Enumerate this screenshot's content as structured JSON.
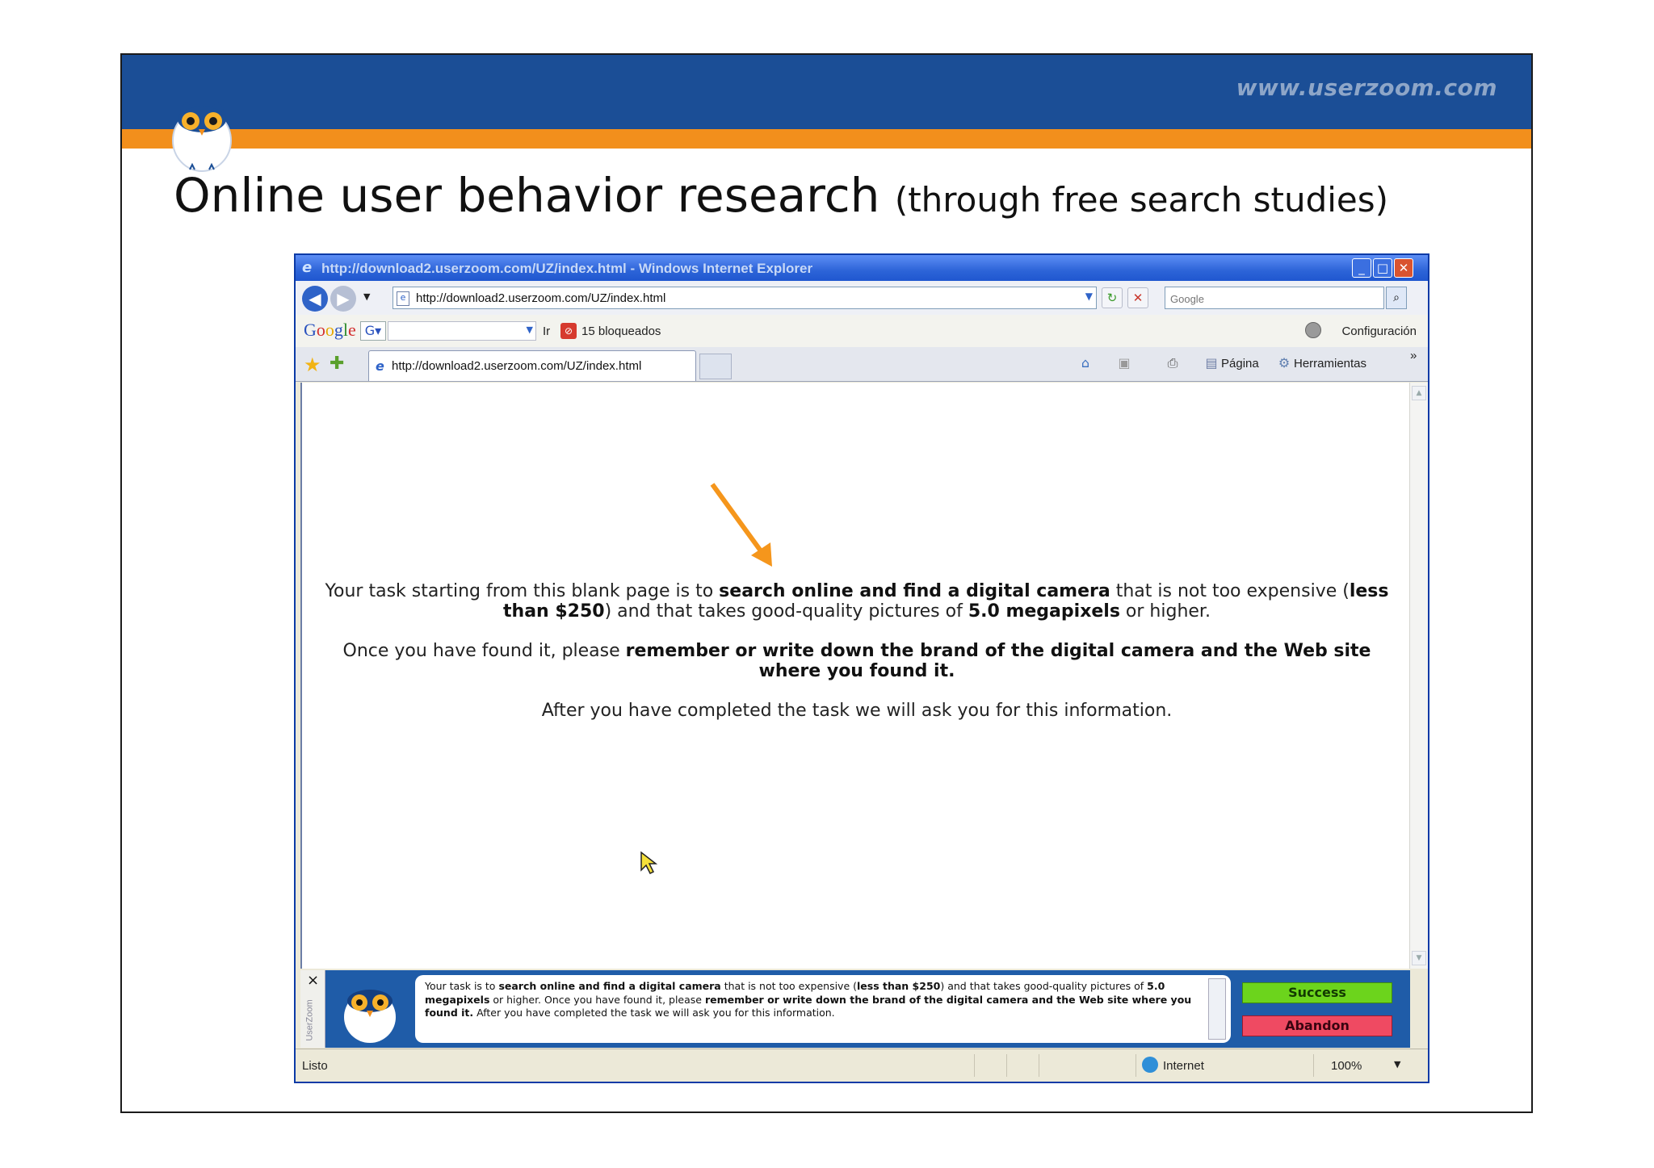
{
  "slide": {
    "brand_url": "www.userzoom.com",
    "title_main": "Online user behavior research",
    "title_sub": "(through free search studies)",
    "colors": {
      "band": "#1b4e96",
      "stripe": "#f28f1c"
    }
  },
  "browser": {
    "window_title": "http://download2.userzoom.com/UZ/index.html - Windows Internet Explorer",
    "address": "http://download2.userzoom.com/UZ/index.html",
    "search_placeholder": "Google",
    "google_bar": {
      "logo": "Google",
      "go_label": "Ir",
      "blocked_label": "15 bloqueados",
      "config_label": "Configuración"
    },
    "tab_label": "http://download2.userzoom.com/UZ/index.html",
    "command_bar": {
      "page_label": "Página",
      "tools_label": "Herramientas"
    },
    "status": {
      "text": "Listo",
      "zone": "Internet",
      "zoom": "100%"
    }
  },
  "task": {
    "p1_a": "Your task starting from this blank page is to ",
    "p1_b": "search online and find a digital camera",
    "p1_c": " that is not too expensive (",
    "p1_d": "less than $250",
    "p1_e": ") and that takes good-quality pictures of ",
    "p1_f": "5.0 megapixels",
    "p1_g": " or higher.",
    "p2_a": "Once you have found it, please ",
    "p2_b": "remember or write down the brand of the digital camera and the Web site where you found it.",
    "p3": "After you have completed the task we will ask you for this information."
  },
  "userzoom_bar": {
    "side_label": "UserZoom",
    "close_glyph": "×",
    "msg_a": "Your task is to ",
    "msg_b": "search online and find a digital camera",
    "msg_c": " that is not too expensive (",
    "msg_d": "less than $250",
    "msg_e": ") and that takes good-quality pictures of ",
    "msg_f": "5.0 megapixels",
    "msg_g": " or higher. Once you have found it, please ",
    "msg_h": "remember or write down the brand of the digital camera and the Web site where you found it.",
    "msg_i": " After you have completed the task we will ask you for this information.",
    "success_label": "Success",
    "abandon_label": "Abandon",
    "colors": {
      "success": "#6cd41c",
      "abandon": "#ef4a62"
    }
  },
  "icons": [
    "owl-logo-icon",
    "ie-icon",
    "back-icon",
    "forward-icon",
    "refresh-icon",
    "stop-icon",
    "search-icon",
    "favorites-star-icon",
    "add-favorite-icon",
    "home-icon",
    "feeds-icon",
    "print-icon",
    "page-icon",
    "tools-icon",
    "globe-icon",
    "zoom-icon",
    "orange-arrow-icon",
    "cursor-icon"
  ]
}
